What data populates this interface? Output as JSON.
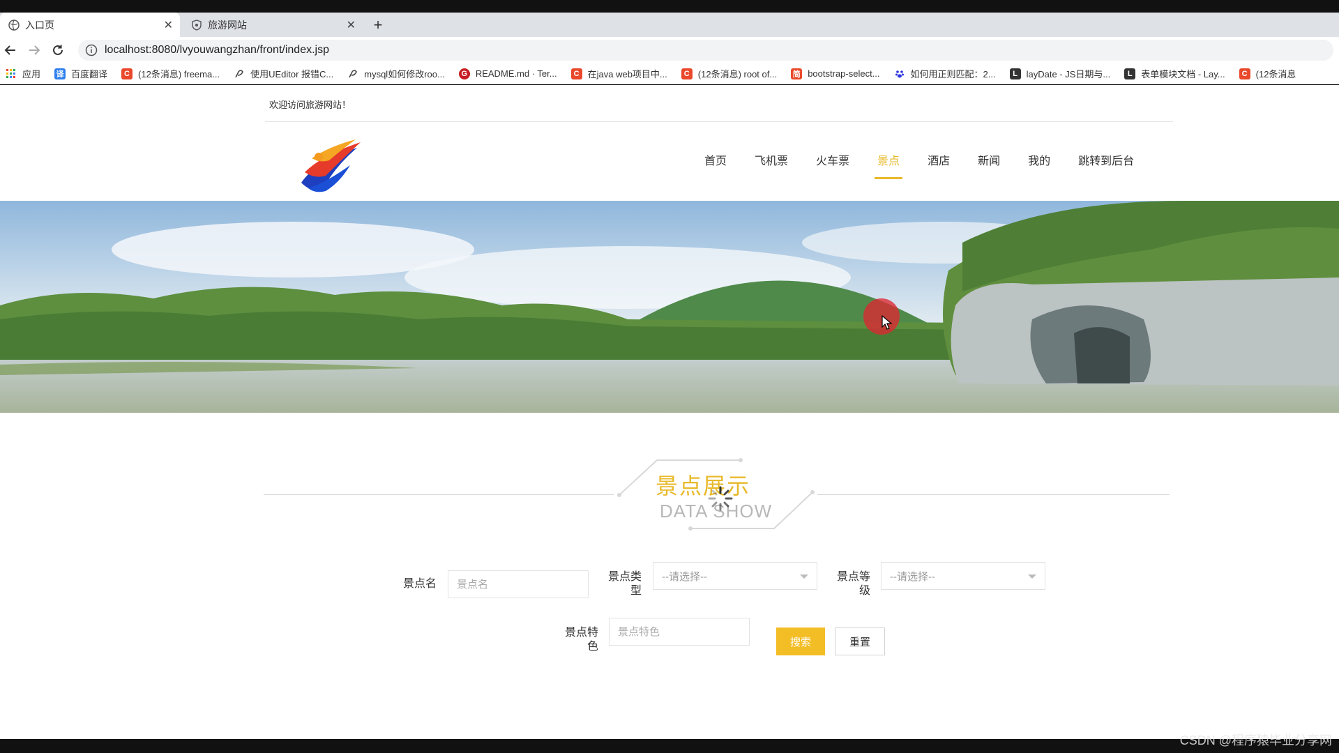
{
  "browser": {
    "tabs": [
      {
        "title": "入口页",
        "active": true
      },
      {
        "title": "旅游网站",
        "active": false
      }
    ],
    "new_tab": "+",
    "url": "localhost:8080/lvyouwangzhan/front/index.jsp",
    "bookmarks": [
      {
        "label": "应用",
        "icon": "apps-grid-icon",
        "color": "#1a73e8"
      },
      {
        "label": "百度翻译",
        "icon": "baidu-translate-icon",
        "color": "#2f80ed"
      },
      {
        "label": "(12条消息) freema...",
        "icon": "csdn-icon",
        "color": "#e9482b"
      },
      {
        "label": "使用UEditor 报错C...",
        "icon": "search-suggest-icon",
        "color": "#555555"
      },
      {
        "label": "mysql如何修改roo...",
        "icon": "search-suggest-icon",
        "color": "#555555"
      },
      {
        "label": "README.md · Ter...",
        "icon": "gitee-icon",
        "color": "#c71d23"
      },
      {
        "label": "在java web项目中...",
        "icon": "csdn-icon",
        "color": "#e9482b"
      },
      {
        "label": "(12条消息) root of...",
        "icon": "csdn-icon",
        "color": "#e9482b"
      },
      {
        "label": "bootstrap-select...",
        "icon": "jianshu-icon",
        "color": "#e9482b"
      },
      {
        "label": "如何用正则匹配：2...",
        "icon": "baidu-paw-icon",
        "color": "#2932e1"
      },
      {
        "label": "layDate - JS日期与...",
        "icon": "layui-icon",
        "color": "#333333"
      },
      {
        "label": "表单模块文档 - Lay...",
        "icon": "layui-icon",
        "color": "#333333"
      },
      {
        "label": "(12条消息",
        "icon": "csdn-icon",
        "color": "#e9482b"
      }
    ]
  },
  "page": {
    "welcome": "欢迎访问旅游网站！",
    "nav": [
      {
        "label": "首页",
        "active": false
      },
      {
        "label": "飞机票",
        "active": false
      },
      {
        "label": "火车票",
        "active": false
      },
      {
        "label": "景点",
        "active": true
      },
      {
        "label": "酒店",
        "active": false
      },
      {
        "label": "新闻",
        "active": false
      },
      {
        "label": "我的",
        "active": false
      },
      {
        "label": "跳转到后台",
        "active": false
      }
    ],
    "carousel": {
      "slides": 2,
      "active_index": 0,
      "active_color": "#f0743a",
      "inactive_color": "#ffffff"
    },
    "section": {
      "title_cn": "景点展示",
      "title_en": "DATA SHOW"
    },
    "form": {
      "name_label": "景点名",
      "name_placeholder": "景点名",
      "type_label": "景点类型",
      "type_value": "--请选择--",
      "level_label": "景点等级",
      "level_value": "--请选择--",
      "feature_label": "景点特色",
      "feature_placeholder": "景点特色",
      "search_label": "搜索",
      "reset_label": "重置"
    },
    "colors": {
      "accent": "#e8b92a",
      "search_button": "#f3bd25"
    }
  },
  "watermark": "CSDN @程序猿毕业分享网"
}
